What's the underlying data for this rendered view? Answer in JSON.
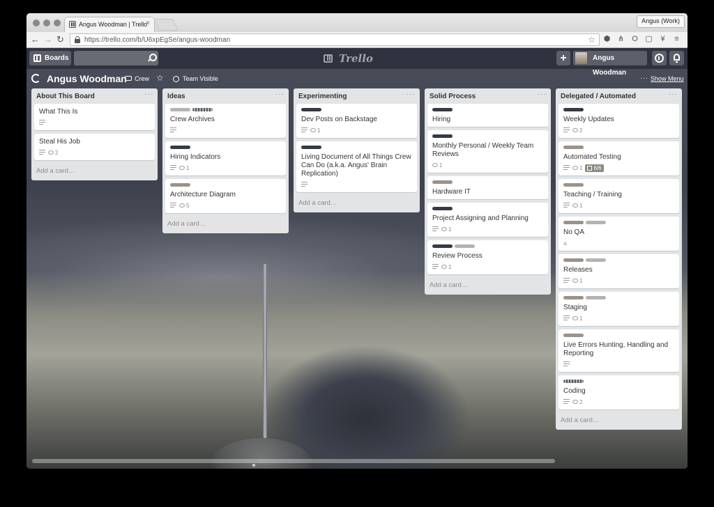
{
  "browser": {
    "tab_title": "Angus Woodman | Trello",
    "tab_close": "×",
    "profile_label": "Angus (Work)",
    "url": "https://trello.com/b/U6xpEgSe/angus-woodman",
    "nav": {
      "back": "←",
      "forward": "→",
      "reload": "↻"
    },
    "url_star": "☆",
    "extensions": [
      {
        "name": "hexagon-extension-icon",
        "glyph": "⬢"
      },
      {
        "name": "pitchfork-extension-icon",
        "glyph": "⋔"
      },
      {
        "name": "opera-extension-icon",
        "glyph": "O"
      },
      {
        "name": "box-extension-icon",
        "glyph": "▢"
      },
      {
        "name": "y-extension-icon",
        "glyph": "¥"
      },
      {
        "name": "hamburger-menu-icon",
        "glyph": "≡"
      }
    ]
  },
  "header": {
    "boards_label": "Boards",
    "logo_text": "Trello",
    "add_label": "+",
    "member_name": "Angus Woodman"
  },
  "board": {
    "title": "Angus Woodman",
    "team": "Crew",
    "star": "☆",
    "visibility": "Team Visible",
    "menu_dots": "···",
    "show_menu": "Show Menu"
  },
  "lists": [
    {
      "title": "About This Board",
      "menu": "···",
      "add_card": "Add a card…",
      "cards": [
        {
          "title": "What This Is",
          "labels": [],
          "desc": true
        },
        {
          "title": "Steal His Job",
          "labels": [],
          "desc": true,
          "comments": "2"
        }
      ]
    },
    {
      "title": "Ideas",
      "menu": "···",
      "add_card": "Add a card…",
      "cards": [
        {
          "title": "Crew Archives",
          "labels": [
            "gray",
            "stripe"
          ],
          "desc": true
        },
        {
          "title": "Hiring Indicators",
          "labels": [
            "dark"
          ],
          "desc": true,
          "comments": "1"
        },
        {
          "title": "Architecture Diagram",
          "labels": [
            "tan"
          ],
          "desc": true,
          "comments": "5"
        }
      ]
    },
    {
      "title": "Experimenting",
      "menu": "···",
      "add_card": "Add a card…",
      "cards": [
        {
          "title": "Dev Posts on Backstage",
          "labels": [
            "dark"
          ],
          "desc": true,
          "comments": "1"
        },
        {
          "title": "Living Document of All Things Crew Can Do (a.k.a. Angus' Brain Replication)",
          "labels": [
            "dark"
          ],
          "desc": true
        }
      ]
    },
    {
      "title": "Solid Process",
      "menu": "···",
      "add_card": "Add a card…",
      "cards": [
        {
          "title": "Hiring",
          "labels": [
            "dark"
          ]
        },
        {
          "title": "Monthly Personal / Weekly Team Reviews",
          "labels": [
            "dark"
          ],
          "comments": "1"
        },
        {
          "title": "Hardware IT",
          "labels": [
            "tan"
          ]
        },
        {
          "title": "Project Assigning and Planning",
          "labels": [
            "dark"
          ],
          "desc": true,
          "comments": "1"
        },
        {
          "title": "Review Process",
          "labels": [
            "dark",
            "gray"
          ],
          "desc": true,
          "comments": "1"
        }
      ]
    },
    {
      "title": "Delegated / Automated",
      "menu": "···",
      "add_card": "Add a card…",
      "cards": [
        {
          "title": "Weekly Updates",
          "labels": [
            "dark"
          ],
          "desc": true,
          "comments": "2"
        },
        {
          "title": "Automated Testing",
          "labels": [
            "tan"
          ],
          "desc": true,
          "comments": "1",
          "checklist": "6/6"
        },
        {
          "title": "Teaching / Training",
          "labels": [
            "tan"
          ],
          "desc": true,
          "comments": "1"
        },
        {
          "title": "No QA",
          "labels": [
            "tan",
            "gray"
          ],
          "attachment": true
        },
        {
          "title": "Releases",
          "labels": [
            "tan",
            "gray"
          ],
          "desc": true,
          "comments": "1"
        },
        {
          "title": "Staging",
          "labels": [
            "tan",
            "gray"
          ],
          "desc": true,
          "comments": "1"
        },
        {
          "title": "Live Errors Hunting, Handling and Reporting",
          "labels": [
            "tan"
          ],
          "desc": true
        },
        {
          "title": "Coding",
          "labels": [
            "stripe"
          ],
          "desc": true,
          "comments": "2"
        }
      ]
    }
  ]
}
